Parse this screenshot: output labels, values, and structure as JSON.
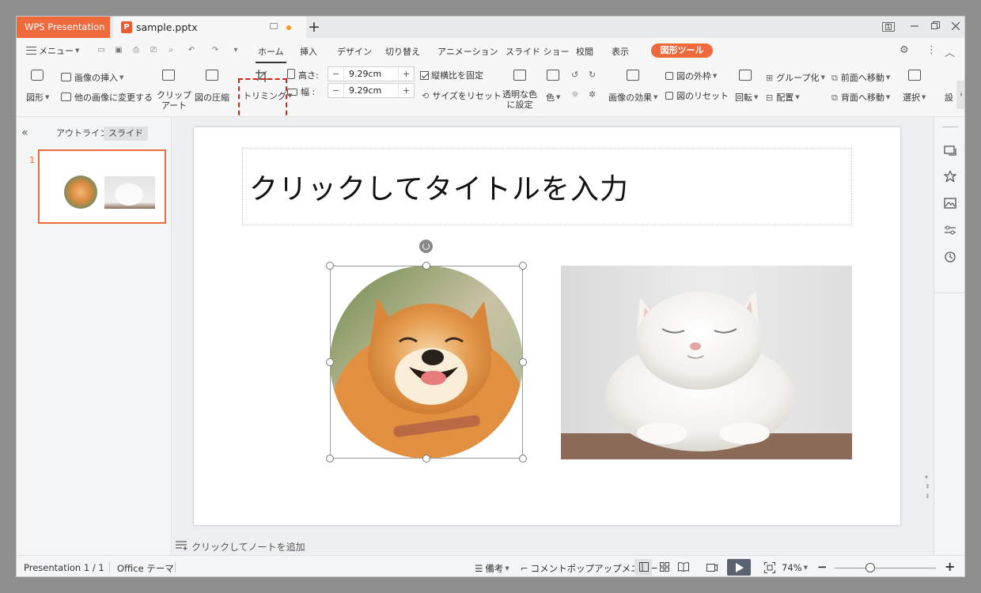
{
  "titlebar": {
    "app_name": "WPS Presentation",
    "doc_icon": "P",
    "doc_name": "sample.pptx",
    "new_tab": "+",
    "layout_icon_label": "1"
  },
  "menu": {
    "menu_label": "メニュー",
    "tabs": [
      "ホーム",
      "挿入",
      "デザイン",
      "切り替え",
      "アニメーション",
      "スライド ショー",
      "校閲",
      "表示"
    ],
    "active_tab": "ホーム",
    "context_tab": "図形ツール"
  },
  "ribbon": {
    "shape": "図形",
    "insert_image": "画像の挿入",
    "change_image": "他の画像に変更する",
    "clipart_1": "クリップ",
    "clipart_2": "アート",
    "compress": "図の圧縮",
    "trim": "トリミング",
    "height_label": "高さ:",
    "height_value": "9.29cm",
    "width_label": "幅 :",
    "width_value": "9.29cm",
    "lock_ratio": "縦横比を固定",
    "reset_size": "サイズをリセット",
    "transparent_1": "透明な色",
    "transparent_2": "に設定",
    "color": "色",
    "image_effect": "画像の効果",
    "outline": "図の外枠",
    "reset_image": "図のリセット",
    "rotate": "回転",
    "group": "グループ化",
    "align": "配置",
    "bring_forward": "前面へ移動",
    "send_backward": "背面へ移動",
    "select": "選択",
    "settings_short": "設"
  },
  "left_panel": {
    "outline_tab": "アウトライン",
    "slide_tab": "スライド",
    "slide_number": "1"
  },
  "slide": {
    "title_placeholder": "クリックしてタイトルを入力"
  },
  "notes": {
    "placeholder": "クリックしてノートを追加"
  },
  "status": {
    "presentation": "Presentation 1 / 1",
    "theme": "Office テーマ",
    "notes_btn": "備考",
    "comment_btn": "コメントポップアップメニュー",
    "zoom": "74%"
  },
  "colors": {
    "accent": "#ee6a3c",
    "highlight_border": "#d6261b"
  }
}
